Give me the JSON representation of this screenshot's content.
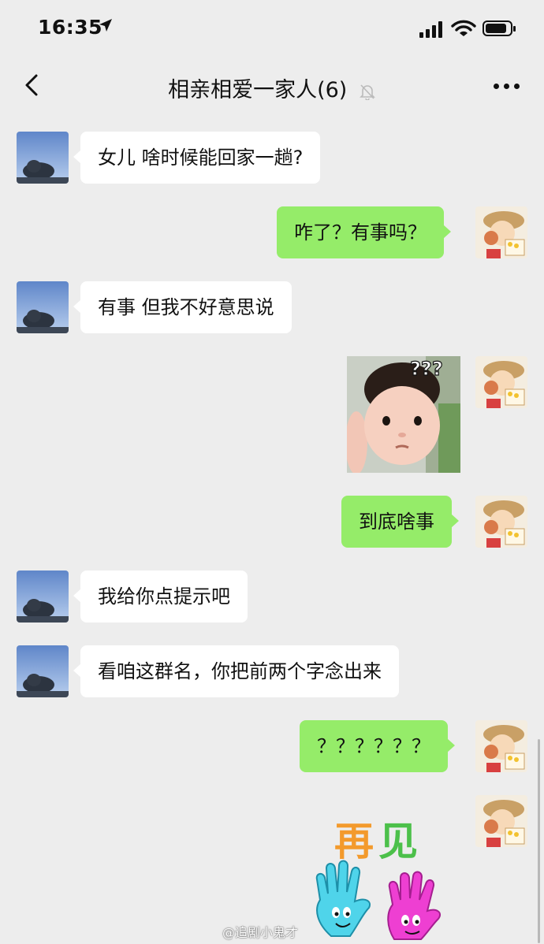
{
  "status_bar": {
    "time": "16:35"
  },
  "header": {
    "title": "相亲相爱一家人(6)"
  },
  "messages": [
    {
      "side": "left",
      "text": "女儿 啥时候能回家一趟?"
    },
    {
      "side": "right",
      "text": "咋了？有事吗？"
    },
    {
      "side": "left",
      "text": "有事 但我不好意思说"
    },
    {
      "side": "right",
      "sticker": "baby-photo",
      "sticker_text": "???"
    },
    {
      "side": "right",
      "text": "到底啥事"
    },
    {
      "side": "left",
      "text": "我给你点提示吧"
    },
    {
      "side": "left",
      "text": "看咱这群名，你把前两个字念出来"
    },
    {
      "side": "right",
      "text": "？？？？？？"
    },
    {
      "side": "right",
      "sticker": "goodbye-hands",
      "sticker_text": "再见"
    }
  ],
  "watermark": "@追剧小鬼才",
  "colors": {
    "background": "#ededed",
    "outgoing_bubble": "#95ec69",
    "incoming_bubble": "#ffffff"
  }
}
